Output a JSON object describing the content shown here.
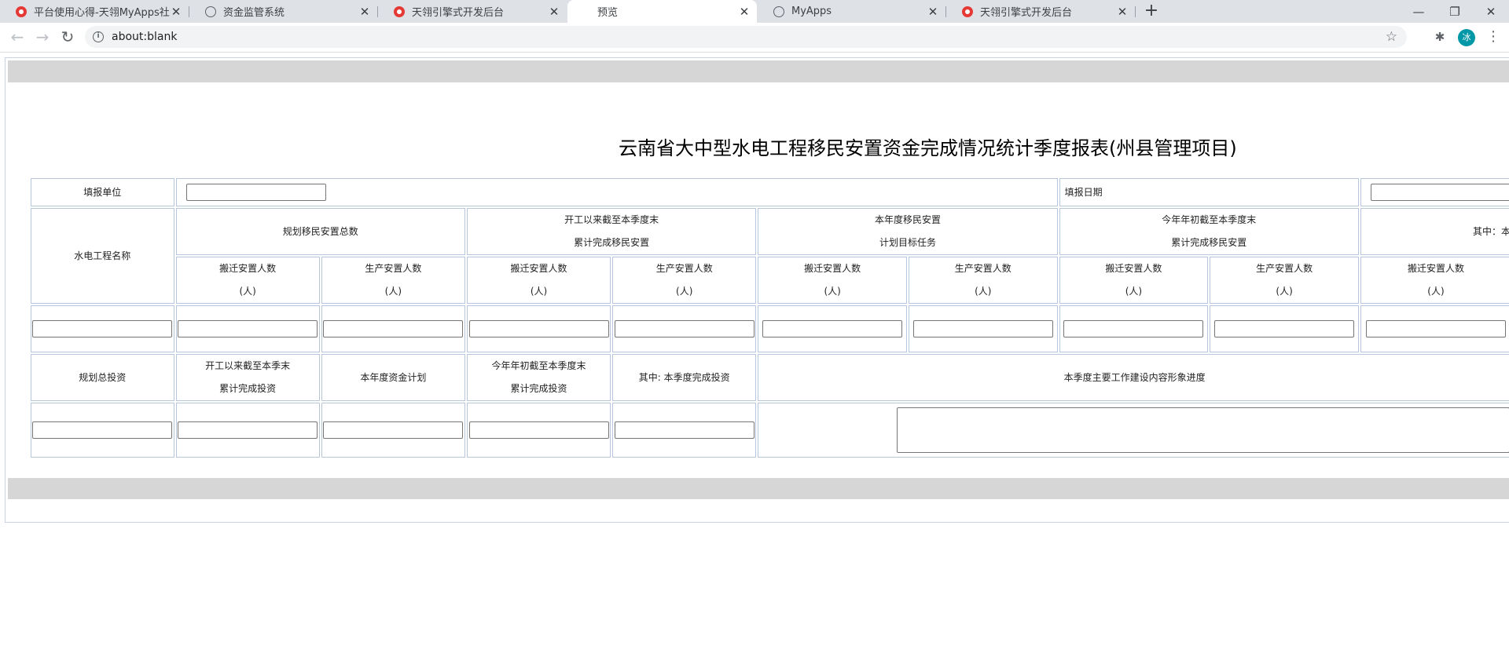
{
  "browser": {
    "tabs": [
      {
        "title": "平台使用心得-天翎MyApps社区",
        "icon": "red-app-icon"
      },
      {
        "title": "资金监管系统",
        "icon": "globe-icon"
      },
      {
        "title": "天翎引擎式开发后台",
        "icon": "red-app-icon"
      },
      {
        "title": "预览",
        "icon": "none",
        "active": true
      },
      {
        "title": "MyApps",
        "icon": "globe-icon"
      },
      {
        "title": "天翎引擎式开发后台",
        "icon": "red-app-icon"
      }
    ],
    "close_glyph": "✕",
    "new_tab": "+",
    "window_controls": {
      "minimize": "—",
      "restore": "❐",
      "close": "✕"
    },
    "address": {
      "url": "about:blank"
    },
    "avatar_text": "冰"
  },
  "report": {
    "title": "云南省大中型水电工程移民安置资金完成情况统计季度报表(州县管理项目)",
    "fill_unit_label": "填报单位",
    "fill_date_label": "填报日期",
    "project_name_label": "水电工程名称",
    "groups": [
      {
        "line1": "规划移民安置总数",
        "line2": ""
      },
      {
        "line1": "开工以来截至本季度末",
        "line2": "累计完成移民安置"
      },
      {
        "line1": "本年度移民安置",
        "line2": "计划目标任务"
      },
      {
        "line1": "今年年初截至本季度末",
        "line2": "累计完成移民安置"
      },
      {
        "line1": "其中：本",
        "line2": ""
      }
    ],
    "sub_headers": [
      {
        "line1": "搬迁安置人数",
        "line2": "(人)"
      },
      {
        "line1": "生产安置人数",
        "line2": "(人)"
      },
      {
        "line1": "搬迁安置人数",
        "line2": "(人)"
      },
      {
        "line1": "生产安置人数",
        "line2": "(人)"
      },
      {
        "line1": "搬迁安置人数",
        "line2": "(人)"
      },
      {
        "line1": "生产安置人数",
        "line2": "(人)"
      },
      {
        "line1": "搬迁安置人数",
        "line2": "(人)"
      },
      {
        "line1": "生产安置人数",
        "line2": "(人)"
      },
      {
        "line1": "搬迁安置人数",
        "line2": "(人)"
      }
    ],
    "invest_headers": [
      {
        "line1": "规划总投资",
        "line2": ""
      },
      {
        "line1": "开工以来截至本季末",
        "line2": "累计完成投资"
      },
      {
        "line1": "本年度资金计划",
        "line2": ""
      },
      {
        "line1": "今年年初截至本季度末",
        "line2": "累计完成投资"
      },
      {
        "line1": "其中: 本季度完成投资",
        "line2": ""
      }
    ],
    "progress_label": "本季度主要工作建设内容形象进度"
  }
}
